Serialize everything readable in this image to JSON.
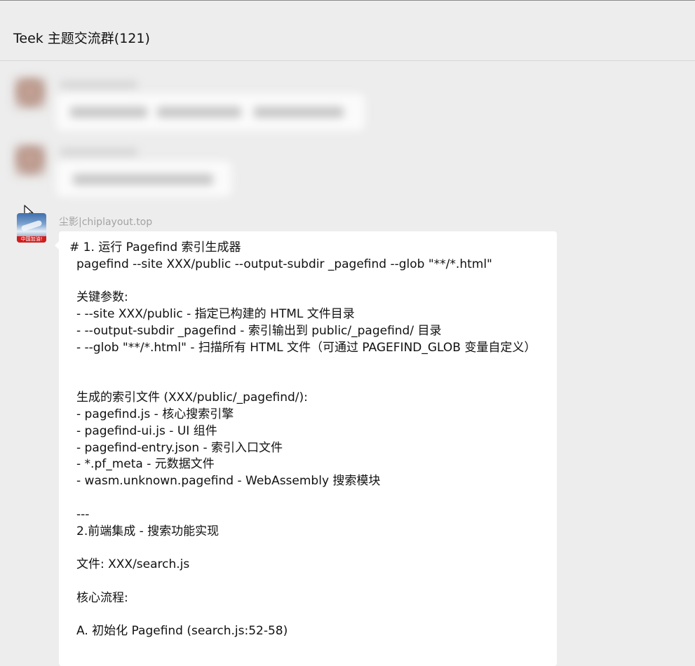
{
  "header": {
    "title": "Teek 主题交流群(121)"
  },
  "message": {
    "sender": "尘影|chiplayout.top",
    "avatar_badge": "中国加油!",
    "lines": [
      "# 1. 运行 Pagefind 索引生成器",
      "pagefind --site XXX/public --output-subdir _pagefind --glob \"**/*.html\"",
      "",
      "关键参数:",
      "- --site XXX/public - 指定已构建的 HTML 文件目录",
      "- --output-subdir _pagefind - 索引输出到 public/_pagefind/ 目录",
      "- --glob \"**/*.html\" - 扫描所有 HTML 文件（可通过 PAGEFIND_GLOB 变量自定义）",
      "",
      "",
      "生成的索引文件 (XXX/public/_pagefind/):",
      "- pagefind.js - 核心搜索引擎",
      "- pagefind-ui.js - UI 组件",
      "- pagefind-entry.json - 索引入口文件",
      "- *.pf_meta - 元数据文件",
      "- wasm.unknown.pagefind - WebAssembly 搜索模块",
      "",
      "---",
      "2.前端集成 - 搜索功能实现",
      "",
      "文件: XXX/search.js",
      "",
      "核心流程:",
      "",
      "A. 初始化 Pagefind (search.js:52-58)"
    ]
  },
  "colors": {
    "background": "#ededed",
    "bubble": "#ffffff",
    "sender": "#a3a3a3",
    "badge": "#cf1f1f"
  }
}
